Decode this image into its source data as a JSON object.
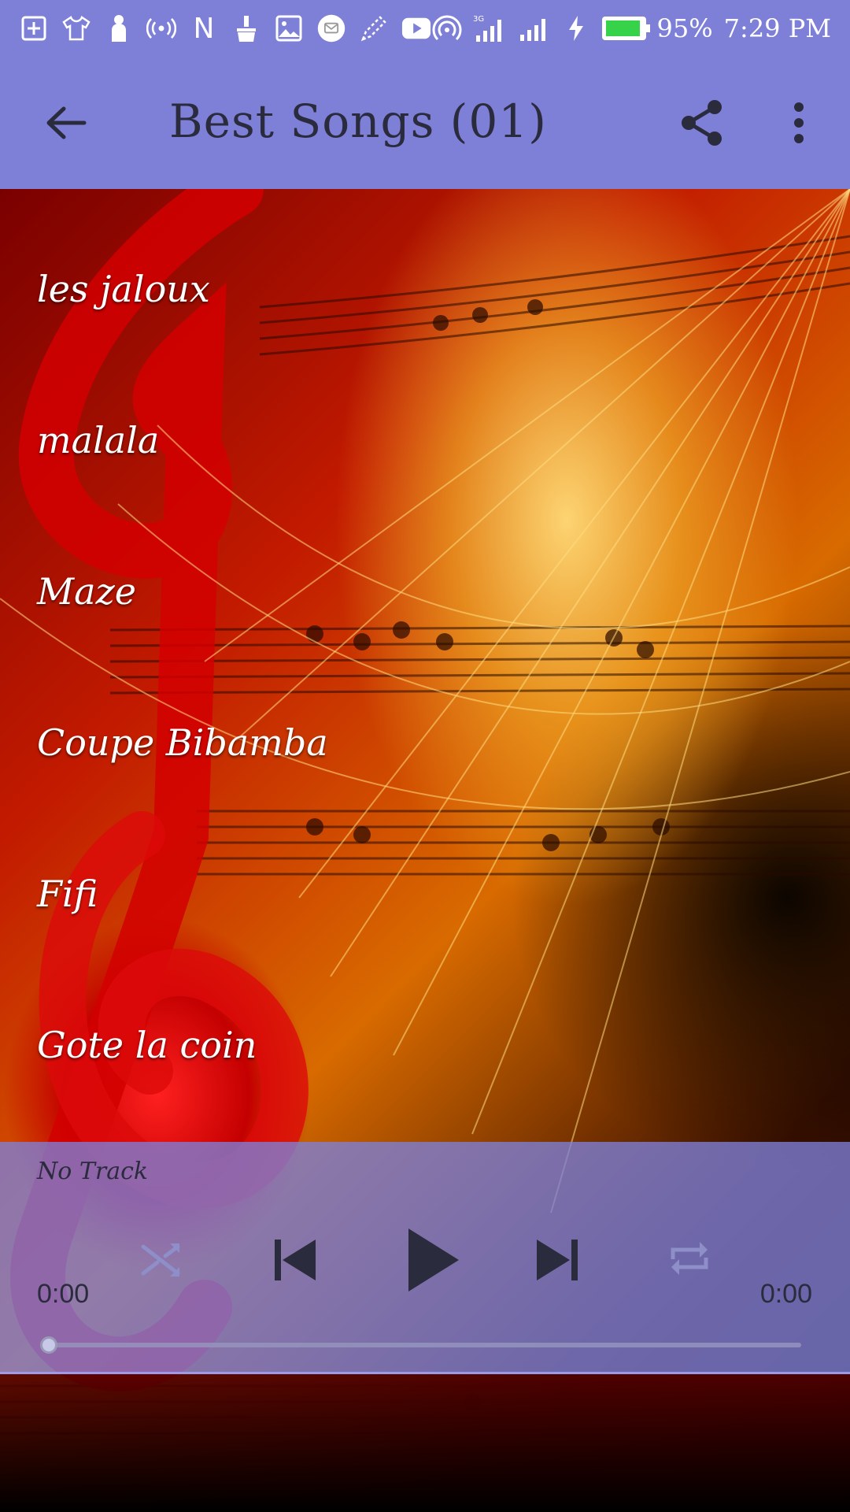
{
  "status_bar": {
    "battery": "95%",
    "time": "7:29 PM",
    "network": "3G",
    "icons": [
      "plus-box-icon",
      "tshirt-icon",
      "person-icon",
      "broadcast-icon",
      "n-icon",
      "broom-icon",
      "image-icon",
      "mail-icon",
      "pen-icon",
      "youtube-icon",
      "hotspot-icon",
      "signal-icon",
      "signal-icon-2",
      "charging-icon",
      "battery-icon"
    ]
  },
  "app_bar": {
    "title": "Best Songs (01)",
    "back_icon": "arrow-back-icon",
    "share_icon": "share-icon",
    "more_icon": "more-vert-icon"
  },
  "songs": [
    {
      "title": "les jaloux"
    },
    {
      "title": "malala"
    },
    {
      "title": "Maze"
    },
    {
      "title": "Coupe Bibamba"
    },
    {
      "title": "Fifi"
    },
    {
      "title": "Gote la coin"
    }
  ],
  "player": {
    "track": "No Track",
    "current_time": "0:00",
    "total_time": "0:00",
    "progress": 0,
    "controls": [
      "shuffle-icon",
      "skip-previous-icon",
      "play-icon",
      "skip-next-icon",
      "repeat-icon"
    ]
  },
  "colors": {
    "primary": "#7e80d8",
    "title_text": "#2b2b3e",
    "battery_fill": "#35d24a"
  }
}
